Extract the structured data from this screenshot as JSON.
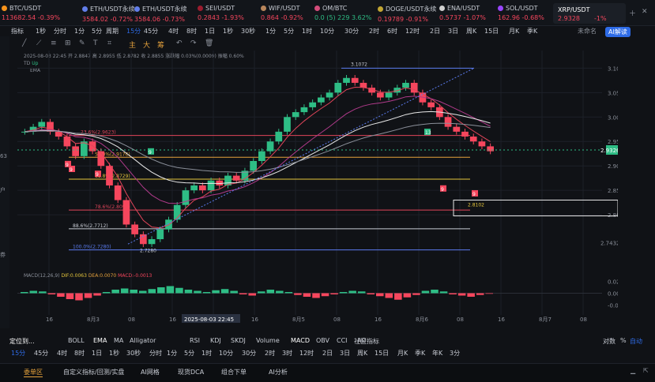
{
  "tickers": [
    {
      "name": "BTC/USDT",
      "price": "113682.54",
      "change": "-0.39%",
      "dir": "dn",
      "dot": "#f7931a"
    },
    {
      "name": "ETH/USDT永续",
      "price": "3584.02",
      "change": "-0.72%",
      "dir": "dn",
      "dot": "#627eea"
    },
    {
      "name": "ETH/USDT永续",
      "price": "3584.06",
      "change": "-0.73%",
      "dir": "dn",
      "dot": "#627eea"
    },
    {
      "name": "SEI/USDT",
      "price": "0.2843",
      "change": "-1.93%",
      "dir": "dn",
      "dot": "#9b1c2e"
    },
    {
      "name": "WIF/USDT",
      "price": "0.864",
      "change": "-0.92%",
      "dir": "dn",
      "dot": "#b8865b"
    },
    {
      "name": "OM/BTC",
      "price": "0.0 (5) 229",
      "change": "3.62%",
      "dir": "up",
      "dot": "#d44c7a"
    },
    {
      "name": "DOGE/USDT永续",
      "price": "0.19789",
      "change": "-0.91%",
      "dir": "dn",
      "dot": "#c2a633"
    },
    {
      "name": "ENA/USDT",
      "price": "0.5737",
      "change": "-1.07%",
      "dir": "dn",
      "dot": "#cfcfcf"
    },
    {
      "name": "SOL/USDT",
      "price": "162.96",
      "change": "-0.68%",
      "dir": "dn",
      "dot": "#9945ff"
    }
  ],
  "active_ticker": {
    "name": "XRP/USDT",
    "price": "2.9328",
    "change": "-1%"
  },
  "toolbar": {
    "indicator": "指标",
    "periods": [
      "1秒",
      "分时",
      "1分",
      "5分",
      "周期"
    ],
    "active_period": "15分",
    "more_periods": [
      "45分",
      "4时",
      "8时",
      "1日",
      "1秒",
      "30秒",
      "1分",
      "5分",
      "1时",
      "10分",
      "30分",
      "2时",
      "6时",
      "12时",
      "2日",
      "3日",
      "周K",
      "15日",
      "月K",
      "季K"
    ],
    "right_label": "未命名",
    "ai_button": "AI解读",
    "draw_tools": [
      "主",
      "大",
      "筹"
    ]
  },
  "left_sidebar": [
    "63",
    "户",
    "券"
  ],
  "chart_info": {
    "line1": "2025-08-03 22:45  开 2.8847 高 2.8955 低 2.8782 收 2.8855 涨跌幅 0.03%(0.0009) 振幅 0.60%",
    "td": "TD",
    "td_up": "Up",
    "ema": "EMA",
    "macd_label": "MACD(12,26,9)",
    "dif": "DIF:0.0063",
    "dea": "DEA:0.0070",
    "macd": "MACD:-0.0013"
  },
  "chart_data": {
    "type": "candlestick",
    "symbol": "XRP/USDT",
    "interval": "15分",
    "ylim": [
      2.7,
      3.12
    ],
    "y_ticks": [
      "3.1000",
      "3.0500",
      "3.0000",
      "2.9500",
      "2.9000",
      "2.8500",
      "2.8000"
    ],
    "x_ticks": [
      "16",
      "8月3",
      "08",
      "16",
      "08",
      "16",
      "8月5",
      "08",
      "16",
      "8月6",
      "08",
      "16",
      "8月7",
      "08"
    ],
    "x_highlight": "2025-08-03 22:45",
    "current_price": "2.9326",
    "marker_price": "2.7432",
    "box_label": "2.8102",
    "high_label": "3.1072",
    "low_label": "2.7280",
    "fib_levels": [
      {
        "label": "23.6%(2.9623)",
        "value": 2.9623,
        "color": "#e0455a"
      },
      {
        "label": "50.0%(2.9176)",
        "value": 2.9176,
        "color": "#e6a23c"
      },
      {
        "label": "61.8%(2.8729)",
        "value": 2.8729,
        "color": "#e6c63c"
      },
      {
        "label": "78.6%(2.8097)",
        "value": 2.8097,
        "color": "#e0455a"
      },
      {
        "label": "88.6%(2.7712)",
        "value": 2.7712,
        "color": "#c7cbd3"
      },
      {
        "label": "100.0%(2.7280)",
        "value": 2.728,
        "color": "#5b7cf0"
      }
    ],
    "td_counts": [
      {
        "label": "9",
        "dir": "dn"
      },
      {
        "label": "9",
        "dir": "dn"
      },
      {
        "label": "9",
        "dir": "dn"
      },
      {
        "label": "9",
        "dir": "up"
      },
      {
        "label": "13",
        "dir": "up"
      },
      {
        "label": "9",
        "dir": "dn"
      },
      {
        "label": "9",
        "dir": "dn"
      }
    ],
    "closes": [
      2.97,
      2.98,
      2.99,
      2.97,
      2.96,
      2.94,
      2.92,
      2.95,
      2.93,
      2.9,
      2.86,
      2.83,
      2.78,
      2.76,
      2.74,
      2.75,
      2.77,
      2.79,
      2.82,
      2.85,
      2.86,
      2.85,
      2.87,
      2.86,
      2.88,
      2.87,
      2.89,
      2.91,
      2.93,
      2.95,
      2.97,
      3.0,
      3.01,
      3.02,
      3.03,
      3.04,
      3.05,
      3.07,
      3.08,
      3.07,
      3.06,
      3.05,
      3.04,
      3.05,
      3.06,
      3.07,
      3.05,
      3.03,
      3.02,
      3.0,
      2.98,
      2.97,
      2.96,
      2.95,
      2.94,
      2.93
    ],
    "macd_ylim": [
      -0.03,
      0.03
    ],
    "macd_ticks": [
      "0.0200",
      "0.0000",
      "-0.0200"
    ],
    "macd_hist": [
      0.002,
      0.004,
      0.003,
      -0.002,
      -0.006,
      -0.01,
      -0.012,
      -0.008,
      -0.004,
      0.002,
      0.006,
      0.008,
      0.006,
      0.004,
      0.007,
      0.01,
      0.012,
      0.009,
      0.006,
      0.004,
      0.002,
      0.005,
      0.007,
      0.004,
      -0.002,
      -0.004,
      0.003,
      0.006,
      0.004,
      0.002,
      -0.003,
      -0.006,
      -0.008,
      -0.005,
      -0.002,
      0.002,
      0.004,
      0.003,
      -0.002,
      -0.005,
      -0.008,
      -0.011,
      -0.007,
      -0.003,
      0.004,
      0.006,
      0.003,
      -0.002,
      -0.004,
      -0.006,
      -0.003,
      -0.001
    ]
  },
  "bottom_bar": {
    "draw_tool": "定位到...",
    "indicators": [
      "BOLL",
      "EMA",
      "MA",
      "Alligator",
      "RSI",
      "KDJ",
      "SKDJ",
      "Volume",
      "MACD",
      "OBV",
      "CCI",
      "AO"
    ],
    "community": "社区指标",
    "right": [
      "对数",
      "%",
      "自动"
    ],
    "periods": [
      "15分",
      "45分",
      "4时",
      "8时",
      "1日",
      "1秒",
      "30秒",
      "分时",
      "1分",
      "5分",
      "1时",
      "10分",
      "30分",
      "2时",
      "3时",
      "12时",
      "2日",
      "3日",
      "周K",
      "15日",
      "月K",
      "季K",
      "年K",
      "3分"
    ]
  },
  "tabs": [
    "委单区",
    "自定义指标/回测/实盘",
    "AI网格",
    "现货DCA",
    "组合下单",
    "AI分析"
  ]
}
